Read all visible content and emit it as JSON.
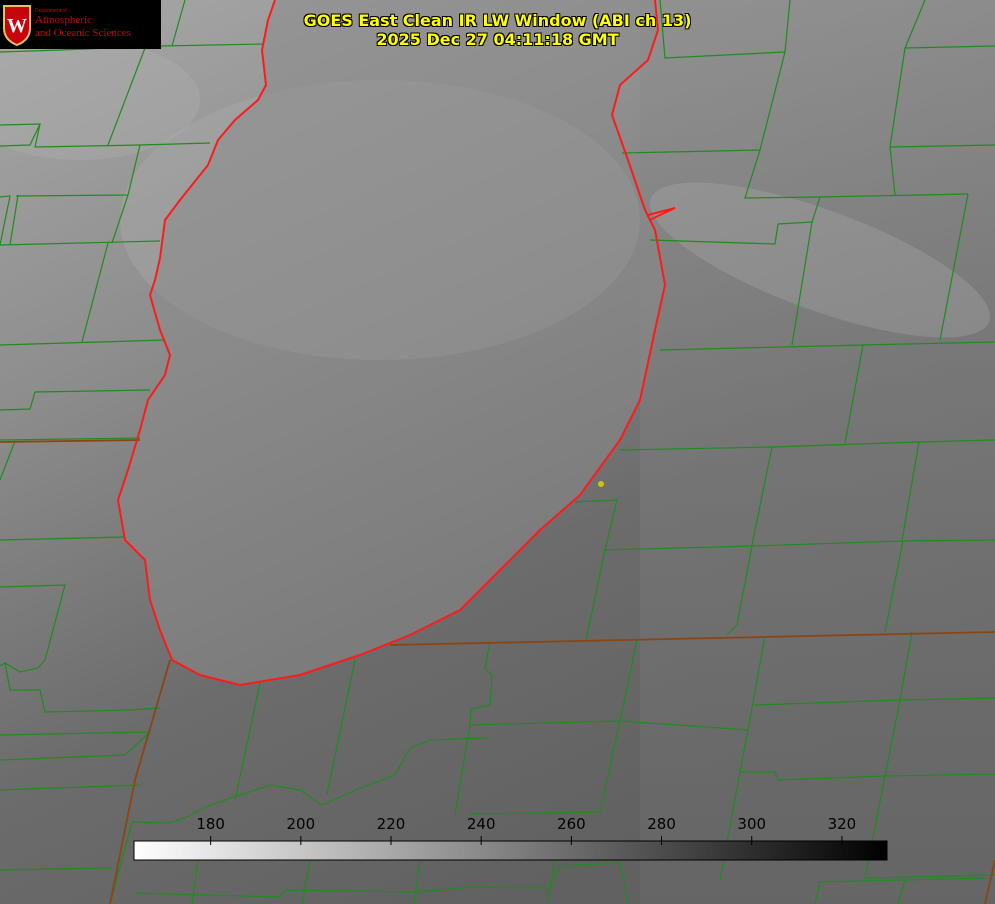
{
  "title": {
    "line1": "GOES East Clean IR LW Window (ABI ch 13)",
    "line2": "2025 Dec 27 04:11:18 GMT"
  },
  "logo": {
    "dept": "Department of",
    "line1": "Atmospheric",
    "line2": "and Oceanic Sciences",
    "icon": "uw-crest-icon"
  },
  "colorbar": {
    "ticks": [
      "180",
      "200",
      "220",
      "240",
      "260",
      "280",
      "300",
      "320"
    ],
    "range": [
      163,
      330
    ]
  },
  "colors": {
    "county_border": "#1e8c1e",
    "state_border": "#8b4513",
    "lake_shoreline": "#ff1a1a",
    "title": "#ffff00",
    "marker": "#d4c400"
  }
}
